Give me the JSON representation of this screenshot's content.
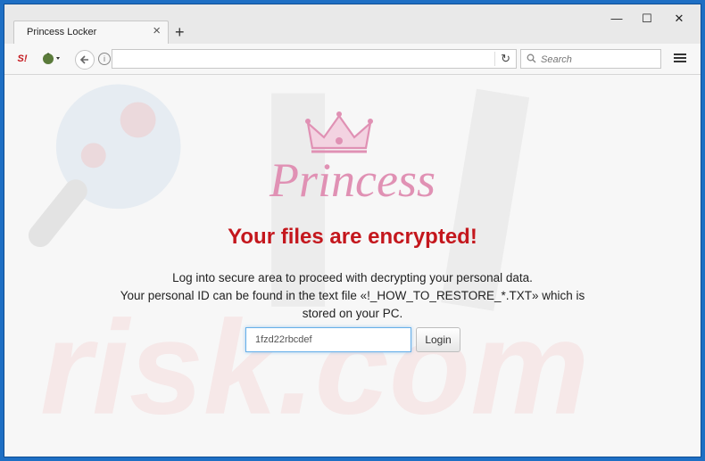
{
  "window": {
    "tab_title": "Princess Locker",
    "tab_close": "×",
    "new_tab": "+",
    "controls": {
      "minimize": "—",
      "maximize": "☐",
      "close": "✕"
    }
  },
  "toolbar": {
    "badge_label": "S!",
    "url_value": "",
    "reload_glyph": "↻",
    "search_placeholder": "Search",
    "search_glyph": "🔍"
  },
  "page": {
    "logo_text": "Princess",
    "headline": "Your files are encrypted!",
    "message_line1": "Log into secure area to proceed with decrypting your personal data.",
    "message_line2": "Your personal ID can be found in the text file «!_HOW_TO_RESTORE_*.TXT» which is",
    "message_line3": "stored on your PC.",
    "id_value": "1fzd22rbcdef",
    "login_label": "Login"
  },
  "colors": {
    "headline": "#c4171d",
    "logo_pink": "#e091b4",
    "window_border": "#1e6fc4"
  },
  "icons": [
    "close-icon",
    "plus-icon",
    "minimize-icon",
    "maximize-icon",
    "back-arrow-icon",
    "info-icon",
    "reload-icon",
    "search-icon",
    "hamburger-menu-icon",
    "crown-icon"
  ]
}
